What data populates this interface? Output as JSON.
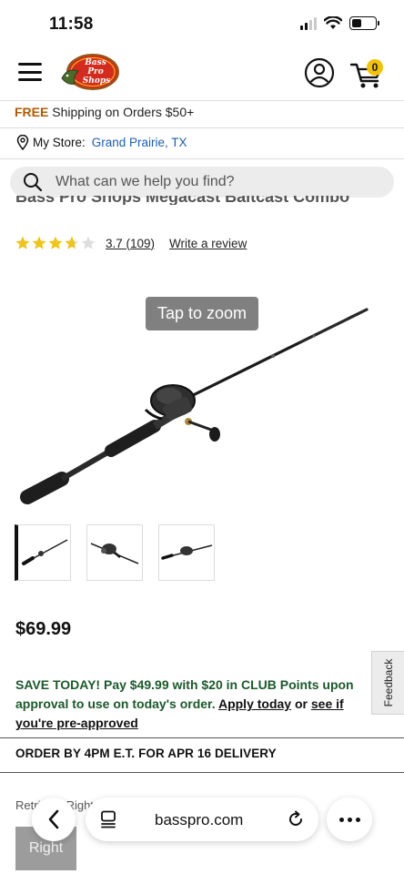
{
  "status_bar": {
    "time": "11:58"
  },
  "header": {
    "logo_text": "Bass Pro Shops",
    "cart_count": "0"
  },
  "shipping": {
    "free_label": "FREE",
    "rest": " Shipping on Orders $50+"
  },
  "store": {
    "label": "My Store:",
    "name": "Grand Prairie, TX"
  },
  "search": {
    "placeholder": "What can we help you find?"
  },
  "product": {
    "title_partial": "Bass Pro Shops Megacast Baitcast Combo",
    "rating_value": 3.7,
    "rating_text": "3.7 (109)",
    "write_review": "Write a review",
    "zoom_hint": "Tap to zoom",
    "price": "$69.99",
    "thumbnail_count": 3
  },
  "promo": {
    "lead": "SAVE TODAY! Pay $49.99 with $20 in CLUB Points upon approval to use on today's order. ",
    "apply_link": "Apply today",
    "or": " or ",
    "preapproved_link": "see if you're pre-approved"
  },
  "delivery": {
    "text": "ORDER BY 4PM E.T. FOR APR 16 DELIVERY"
  },
  "retrieve": {
    "label": "Retrieve: Right",
    "selected_option": "Right"
  },
  "feedback": {
    "label": "Feedback"
  },
  "browser": {
    "url": "basspro.com"
  },
  "colors": {
    "free_text": "#b35a00",
    "store_link": "#1d5fb4",
    "promo_green": "#1a5a2a",
    "star_gold": "#f0c419",
    "cart_badge": "#f3c300"
  }
}
